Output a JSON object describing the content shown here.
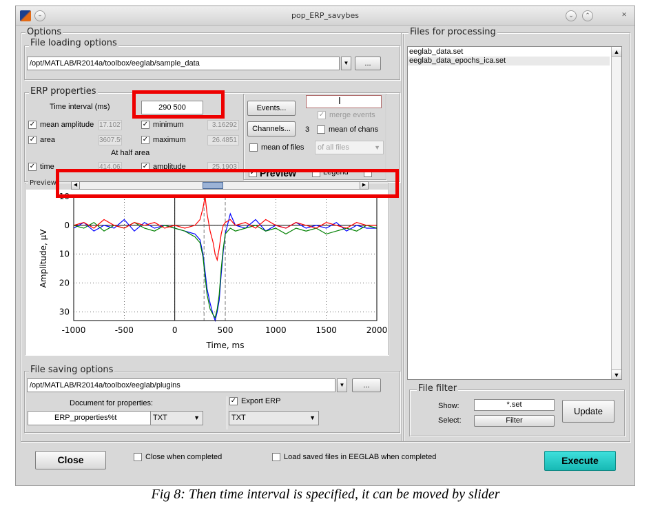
{
  "window": {
    "title": "pop_ERP_savybes"
  },
  "options_group": {
    "label": "Options"
  },
  "file_loading": {
    "label": "File loading options",
    "path": "/opt/MATLAB/R2014a/toolbox/eeglab/sample_data",
    "browse_label": "..."
  },
  "erp_properties": {
    "label": "ERP properties",
    "time_interval_label": "Time interval (ms)",
    "time_interval_value": "290 500",
    "mean_amplitude_label": "mean amplitude",
    "mean_amplitude_value": "17.1027",
    "minimum_label": "minimum",
    "minimum_value": "3.16292",
    "area_label": "area",
    "area_value": "3607.59",
    "maximum_label": "maximum",
    "maximum_value": "26.4851",
    "half_area_label": "At half area",
    "time_label": "time",
    "time_value": "414.062",
    "amplitude_label": "amplitude",
    "amplitude_value": "25.1903"
  },
  "events": {
    "button_label": "Events...",
    "merge_label": "merge events"
  },
  "channels": {
    "button_label": "Channels...",
    "count": "3",
    "mean_of_chans_label": "mean of chans",
    "mean_of_files_label": "mean of files",
    "of_all_files_label": "of all files"
  },
  "preview": {
    "label": "Preview",
    "legend_label": "Legend",
    "group_label": "Preview"
  },
  "plot": {
    "xlabel": "Time, ms",
    "ylabel": "Amplitude, µV"
  },
  "chart_data": {
    "type": "line",
    "xlabel": "Time, ms",
    "ylabel": "Amplitude, µV",
    "xlim": [
      -1000,
      2000
    ],
    "ylim": [
      -10,
      33
    ],
    "y_reversed": true,
    "grid": true,
    "xticks": [
      -1000,
      -500,
      0,
      500,
      1000,
      1500,
      2000
    ],
    "yticks": [
      -10,
      0,
      10,
      20,
      30
    ],
    "interval_markers": [
      290,
      500
    ],
    "series": [
      {
        "color": "#0000ff",
        "x": [
          -1000,
          -900,
          -800,
          -700,
          -600,
          -500,
          -400,
          -300,
          -200,
          -100,
          0,
          100,
          200,
          250,
          280,
          300,
          320,
          350,
          380,
          400,
          420,
          440,
          460,
          480,
          500,
          550,
          600,
          700,
          800,
          900,
          1000,
          1100,
          1200,
          1300,
          1400,
          1500,
          1600,
          1700,
          1800,
          1900,
          2000
        ],
        "y": [
          1,
          -1,
          2,
          0,
          1,
          -2,
          2,
          -1,
          1,
          0,
          1,
          2,
          3,
          5,
          10,
          16,
          22,
          27,
          31,
          33,
          30,
          26,
          17,
          9,
          3,
          -4,
          0,
          1,
          -2,
          2,
          0,
          1,
          -1,
          1,
          0,
          1,
          -1,
          2,
          0,
          1,
          1
        ]
      },
      {
        "color": "#008000",
        "x": [
          -1000,
          -900,
          -800,
          -700,
          -600,
          -500,
          -400,
          -300,
          -200,
          -100,
          0,
          100,
          200,
          250,
          280,
          300,
          320,
          350,
          380,
          400,
          420,
          440,
          460,
          480,
          500,
          550,
          600,
          700,
          800,
          900,
          1000,
          1100,
          1200,
          1300,
          1400,
          1500,
          1600,
          1700,
          1800,
          1900,
          2000
        ],
        "y": [
          0,
          1,
          -1,
          2,
          0,
          1,
          -1,
          1,
          2,
          0,
          1,
          2,
          4,
          6,
          11,
          18,
          24,
          29,
          31,
          32,
          29,
          24,
          15,
          8,
          3,
          1,
          2,
          1,
          0,
          2,
          1,
          3,
          1,
          2,
          1,
          3,
          2,
          1,
          2,
          0,
          1
        ]
      },
      {
        "color": "#ff0000",
        "x": [
          -1000,
          -900,
          -800,
          -700,
          -600,
          -500,
          -400,
          -300,
          -200,
          -100,
          0,
          100,
          200,
          250,
          280,
          300,
          320,
          350,
          380,
          400,
          420,
          440,
          460,
          480,
          500,
          550,
          600,
          700,
          800,
          900,
          1000,
          1100,
          1200,
          1300,
          1400,
          1500,
          1600,
          1700,
          1800,
          1900,
          2000
        ],
        "y": [
          0,
          -1,
          1,
          -2,
          0,
          1,
          -1,
          0,
          -1,
          1,
          0,
          1,
          0,
          -2,
          -6,
          -10,
          -4,
          2,
          6,
          10,
          12,
          8,
          3,
          0,
          -1,
          -2,
          0,
          -1,
          1,
          -2,
          0,
          1,
          -1,
          0,
          1,
          -1,
          0,
          1,
          -1,
          0,
          0
        ]
      }
    ]
  },
  "file_saving": {
    "label": "File saving options",
    "path": "/opt/MATLAB/R2014a/toolbox/eeglab/plugins",
    "browse_label": "...",
    "doc_label": "Document for properties:",
    "doc_name": "ERP_properties%t",
    "doc_format": "TXT",
    "export_label": "Export ERP",
    "export_format": "TXT"
  },
  "files_processing": {
    "label": "Files for processing",
    "files": [
      "eeglab_data.set",
      "eeglab_data_epochs_ica.set"
    ]
  },
  "file_filter": {
    "label": "File filter",
    "show_label": "Show:",
    "show_value": "*.set",
    "select_label": "Select:",
    "filter_button": "Filter",
    "update_button": "Update"
  },
  "bottom": {
    "close_button": "Close",
    "close_when_completed": "Close when completed",
    "load_saved": "Load saved files in EEGLAB when completed",
    "execute_button": "Execute"
  },
  "caption": "Fig 8: Then time interval is specified, it can be moved by slider"
}
